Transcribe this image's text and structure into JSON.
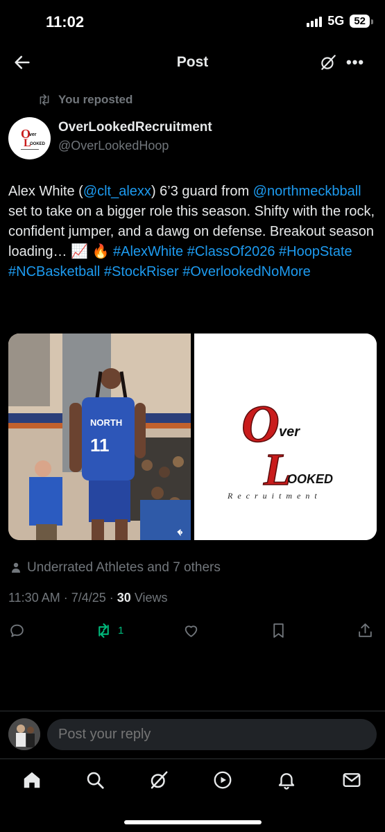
{
  "status_bar": {
    "time": "11:02",
    "network": "5G",
    "battery": "52"
  },
  "header": {
    "title": "Post"
  },
  "repost": {
    "label": "You reposted"
  },
  "author": {
    "name": "OverLookedRecruitment",
    "handle": "@OverLookedHoop"
  },
  "post": {
    "segments": [
      {
        "text": "Alex White (",
        "link": false
      },
      {
        "text": "@clt_alexx",
        "link": true
      },
      {
        "text": ") 6’3 guard from ",
        "link": false
      },
      {
        "text": "@northmeckbball",
        "link": true
      },
      {
        "text": " set to take on a bigger role this season. Shifty with the rock, confident jumper, and a dawg on defense. Breakout season loading… 📈 🔥 ",
        "link": false
      },
      {
        "text": "#AlexWhite",
        "link": true
      },
      {
        "text": " ",
        "link": false
      },
      {
        "text": "#ClassOf2026",
        "link": true
      },
      {
        "text": " ",
        "link": false
      },
      {
        "text": "#HoopState",
        "link": true
      },
      {
        "text": " ",
        "link": false
      },
      {
        "text": "#NCBasketball",
        "link": true
      },
      {
        "text": " ",
        "link": false
      },
      {
        "text": "#StockRiser",
        "link": true
      },
      {
        "text": " ",
        "link": false
      },
      {
        "text": "#OverlookedNoMore",
        "link": true
      }
    ]
  },
  "media": {
    "photo_jersey": "NORTH",
    "photo_number": "11",
    "logo": {
      "top_letter": "O",
      "top_word": "ver",
      "bottom_letter": "L",
      "bottom_word": "OOKED",
      "tagline": "Recruitment"
    }
  },
  "liked_by": "Underrated Athletes and 7 others",
  "meta": {
    "time": "11:30 AM",
    "date": "7/4/25",
    "views_count": "30",
    "views_label": "Views"
  },
  "actions": {
    "retweet_count": "1"
  },
  "reply": {
    "placeholder": "Post your reply"
  },
  "colors": {
    "accent": "#1d9bf0",
    "retweet_green": "#00ba7c",
    "muted": "#71767b",
    "logo_red": "#c91c1c"
  },
  "nav": [
    "home-icon",
    "search-icon",
    "grok-icon",
    "video-icon",
    "notifications-icon",
    "messages-icon"
  ]
}
